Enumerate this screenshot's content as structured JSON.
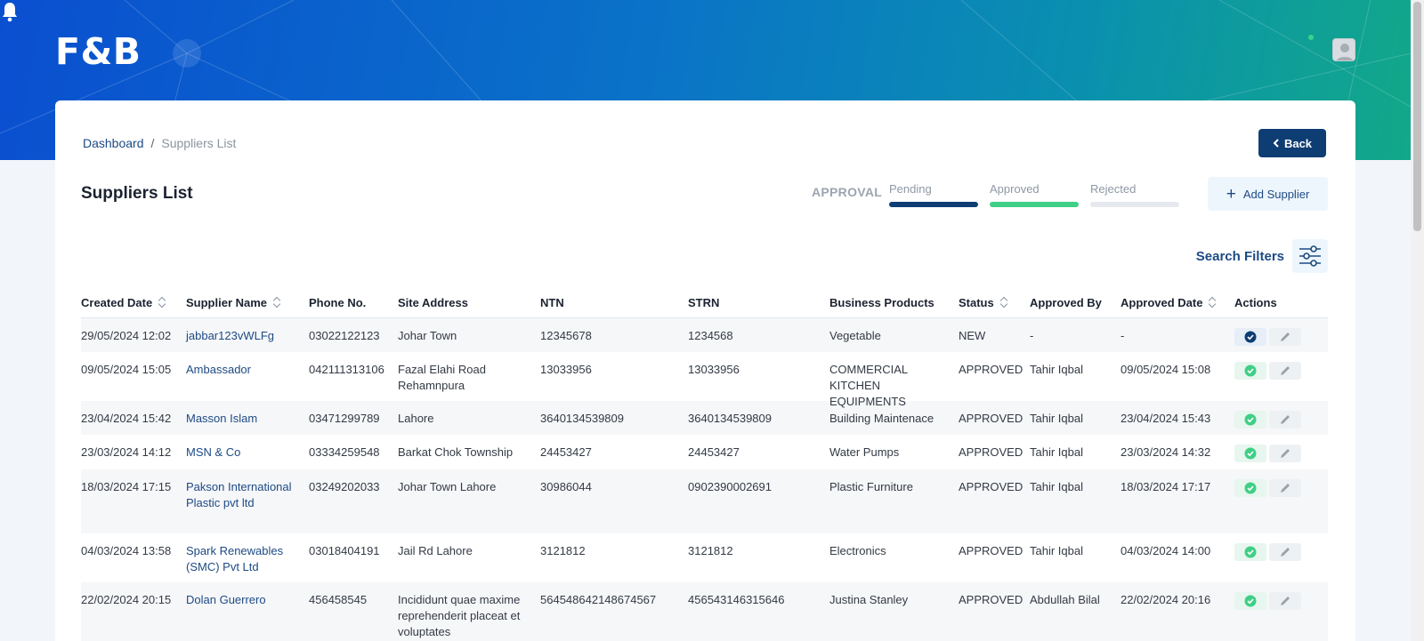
{
  "app": {
    "logo": "F&B"
  },
  "header": {
    "notification_icon": "bell-icon",
    "avatar_icon": "user-avatar-icon"
  },
  "breadcrumb": {
    "home": "Dashboard",
    "separator": "/",
    "current": "Suppliers List"
  },
  "back_button": {
    "label": "Back"
  },
  "page": {
    "title": "Suppliers List"
  },
  "approval": {
    "label": "APPROVAL",
    "tabs": [
      {
        "label": "Pending",
        "color": "#0e3d73"
      },
      {
        "label": "Approved",
        "color": "#3fcf86"
      },
      {
        "label": "Rejected",
        "color": "#e6e9ee"
      }
    ]
  },
  "add_supplier": {
    "label": "Add Supplier"
  },
  "search_filters": {
    "label": "Search Filters"
  },
  "table": {
    "columns": [
      "Created Date",
      "Supplier Name",
      "Phone No.",
      "Site Address",
      "NTN",
      "STRN",
      "Business Products",
      "Status",
      "Approved By",
      "Approved Date",
      "Actions"
    ],
    "rows": [
      {
        "created": "29/05/2024 12:02",
        "name": "jabbar123vWLFg",
        "phone": "03022122123",
        "address": "Johar Town",
        "ntn": "12345678",
        "strn": "1234568",
        "products": "Vegetable",
        "status": "NEW",
        "approved_by": "-",
        "approved_date": "-",
        "action": "verify"
      },
      {
        "created": "09/05/2024 15:05",
        "name": "Ambassador",
        "phone": "042111313106",
        "address": "Fazal Elahi Road Rehamnpura",
        "ntn": "13033956",
        "strn": "13033956",
        "products": "COMMERCIAL KITCHEN EQUIPMENTS",
        "status": "APPROVED",
        "approved_by": "Tahir Iqbal",
        "approved_date": "09/05/2024 15:08",
        "action": "approved"
      },
      {
        "created": "23/04/2024 15:42",
        "name": "Masson Islam",
        "phone": "03471299789",
        "address": "Lahore",
        "ntn": "3640134539809",
        "strn": "3640134539809",
        "products": "Building Maintenace",
        "status": "APPROVED",
        "approved_by": "Tahir Iqbal",
        "approved_date": "23/04/2024 15:43",
        "action": "approved"
      },
      {
        "created": "23/03/2024 14:12",
        "name": "MSN & Co",
        "phone": "03334259548",
        "address": "Barkat Chok Township",
        "ntn": "24453427",
        "strn": "24453427",
        "products": "Water Pumps",
        "status": "APPROVED",
        "approved_by": "Tahir Iqbal",
        "approved_date": "23/03/2024 14:32",
        "action": "approved"
      },
      {
        "created": "18/03/2024 17:15",
        "name": "Pakson International Plastic pvt ltd",
        "phone": "03249202033",
        "address": "Johar Town Lahore",
        "ntn": "30986044",
        "strn": "0902390002691",
        "products": "Plastic Furniture",
        "status": "APPROVED",
        "approved_by": "Tahir Iqbal",
        "approved_date": "18/03/2024 17:17",
        "action": "approved"
      },
      {
        "created": "04/03/2024 13:58",
        "name": "Spark Renewables (SMC) Pvt Ltd",
        "phone": "03018404191",
        "address": "Jail Rd Lahore",
        "ntn": "3121812",
        "strn": "3121812",
        "products": "Electronics",
        "status": "APPROVED",
        "approved_by": "Tahir Iqbal",
        "approved_date": "04/03/2024 14:00",
        "action": "approved"
      },
      {
        "created": "22/02/2024 20:15",
        "name": "Dolan Guerrero",
        "phone": "456458545",
        "address": "Incididunt quae maxime reprehenderit placeat et voluptates",
        "ntn": "564548642148674567",
        "strn": "456543146315646",
        "products": "Justina Stanley",
        "status": "APPROVED",
        "approved_by": "Abdullah Bilal",
        "approved_date": "22/02/2024 20:16",
        "action": "approved"
      }
    ]
  }
}
